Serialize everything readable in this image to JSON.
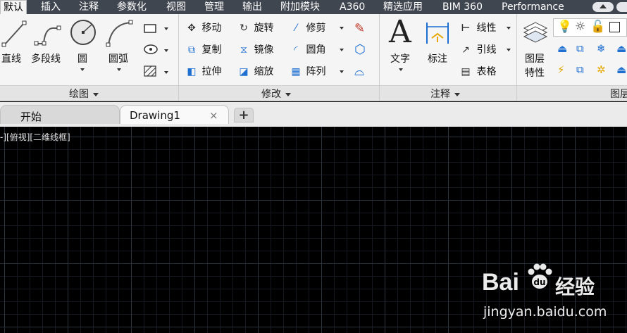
{
  "ribbon_tabs": [
    "默认",
    "插入",
    "注释",
    "参数化",
    "视图",
    "管理",
    "输出",
    "附加模块",
    "A360",
    "精选应用",
    "BIM 360",
    "Performance"
  ],
  "draw_panel": {
    "title": "绘图",
    "line": "直线",
    "polyline": "多段线",
    "circle": "圆",
    "arc": "圆弧"
  },
  "modify_panel": {
    "title": "修改",
    "move": "移动",
    "rotate": "旋转",
    "trim": "修剪",
    "copy": "复制",
    "mirror": "镜像",
    "fillet": "圆角",
    "stretch": "拉伸",
    "scale": "缩放",
    "array": "阵列"
  },
  "annotation_panel": {
    "title": "注释",
    "text": "文字",
    "dimension": "标注",
    "linear": "线性",
    "leader": "引线",
    "table": "表格"
  },
  "layers_panel": {
    "title": "图层",
    "layer_props_line1": "图层",
    "layer_props_line2": "特性"
  },
  "file_tabs": {
    "start": "开始",
    "drawing": "Drawing1",
    "close": "×",
    "new": "+"
  },
  "viewport": {
    "label": "-][俯视][二维线框]"
  },
  "watermark": {
    "brand_a": "Bai",
    "brand_b": "经验",
    "url": "jingyan.baidu.com"
  },
  "colors": {
    "tabbar_bg": "#404650",
    "ribbon_bg": "#f5f5f5",
    "canvas_bg": "#000000",
    "accent_blue": "#1f6fd1"
  }
}
